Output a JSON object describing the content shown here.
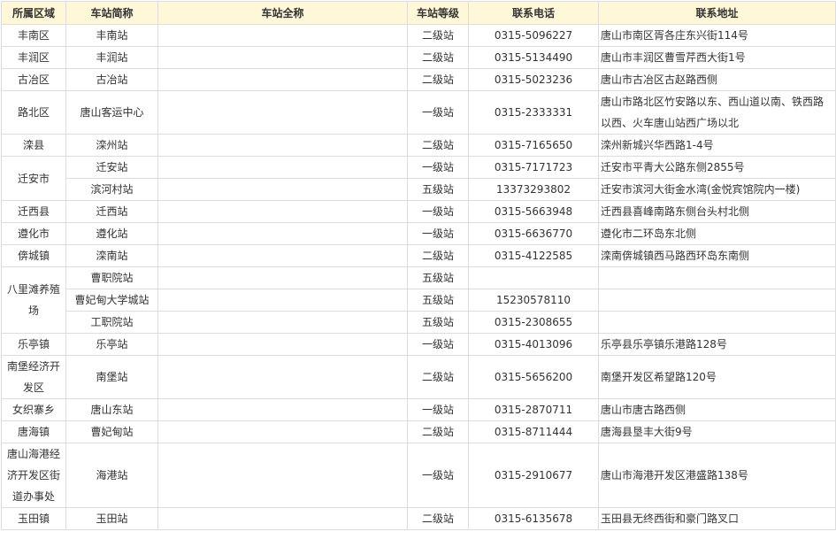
{
  "headers": [
    "所属区域",
    "车站简称",
    "车站全称",
    "车站等级",
    "联系电话",
    "联系地址"
  ],
  "rows": [
    {
      "region": "丰南区",
      "short": "丰南站",
      "full": "",
      "level": "二级站",
      "phone": "0315-5096227",
      "address": "唐山市南区胥各庄东兴街114号"
    },
    {
      "region": "丰润区",
      "short": "丰润站",
      "full": "",
      "level": "二级站",
      "phone": "0315-5134490",
      "address": "唐山市丰润区曹雪芹西大街1号"
    },
    {
      "region": "古冶区",
      "short": "古冶站",
      "full": "",
      "level": "二级站",
      "phone": "0315-5023236",
      "address": "唐山市古冶区古赵路西侧"
    },
    {
      "region": "路北区",
      "short": "唐山客运中心",
      "full": "",
      "level": "一级站",
      "phone": "0315-2333331",
      "address": "唐山市路北区竹安路以东、西山道以南、铁西路以西、火车唐山站西广场以北"
    },
    {
      "region": "滦县",
      "short": "滦州站",
      "full": "",
      "level": "二级站",
      "phone": "0315-7165650",
      "address": "滦州新城兴华西路1-4号"
    },
    {
      "region": "迁安市",
      "short": "迁安站",
      "full": "",
      "level": "一级站",
      "phone": "0315-7171723",
      "address": "迁安市平青大公路东侧2855号"
    },
    {
      "region": "",
      "short": "滨河村站",
      "full": "",
      "level": "五级站",
      "phone": "13373293802",
      "address": "迁安市滨河大街金水湾(金悦宾馆院内一楼)"
    },
    {
      "region": "迁西县",
      "short": "迁西站",
      "full": "",
      "level": "一级站",
      "phone": "0315-5663948",
      "address": "迁西县喜峰南路东侧台头村北侧"
    },
    {
      "region": "遵化市",
      "short": "遵化站",
      "full": "",
      "level": "一级站",
      "phone": "0315-6636770",
      "address": "遵化市二环岛东北侧"
    },
    {
      "region": "倴城镇",
      "short": "滦南站",
      "full": "",
      "level": "二级站",
      "phone": "0315-4122585",
      "address": "滦南倴城镇西马路西环岛东南侧"
    },
    {
      "region": "八里滩养殖场",
      "short": "曹职院站",
      "full": "",
      "level": "五级站",
      "phone": "",
      "address": ""
    },
    {
      "region": "",
      "short": "曹妃甸大学城站",
      "full": "",
      "level": "五级站",
      "phone": "15230578110",
      "address": ""
    },
    {
      "region": "",
      "short": "工职院站",
      "full": "",
      "level": "五级站",
      "phone": "0315-2308655",
      "address": ""
    },
    {
      "region": "乐亭镇",
      "short": "乐亭站",
      "full": "",
      "level": "一级站",
      "phone": "0315-4013096",
      "address": "乐亭县乐亭镇乐港路128号"
    },
    {
      "region": "南堡经济开发区",
      "short": "南堡站",
      "full": "",
      "level": "二级站",
      "phone": "0315-5656200",
      "address": "南堡开发区希望路120号"
    },
    {
      "region": "女织寨乡",
      "short": "唐山东站",
      "full": "",
      "level": "一级站",
      "phone": "0315-2870711",
      "address": "唐山市唐古路西侧"
    },
    {
      "region": "唐海镇",
      "short": "曹妃甸站",
      "full": "",
      "level": "二级站",
      "phone": "0315-8711444",
      "address": "唐海县垦丰大街9号"
    },
    {
      "region": "唐山海港经济开发区街道办事处",
      "short": "海港站",
      "full": "",
      "level": "一级站",
      "phone": "0315-2910677",
      "address": "唐山市海港开发区港盛路138号"
    },
    {
      "region": "玉田镇",
      "short": "玉田站",
      "full": "",
      "level": "二级站",
      "phone": "0315-6135678",
      "address": "玉田县无终西街和豪门路叉口"
    }
  ]
}
